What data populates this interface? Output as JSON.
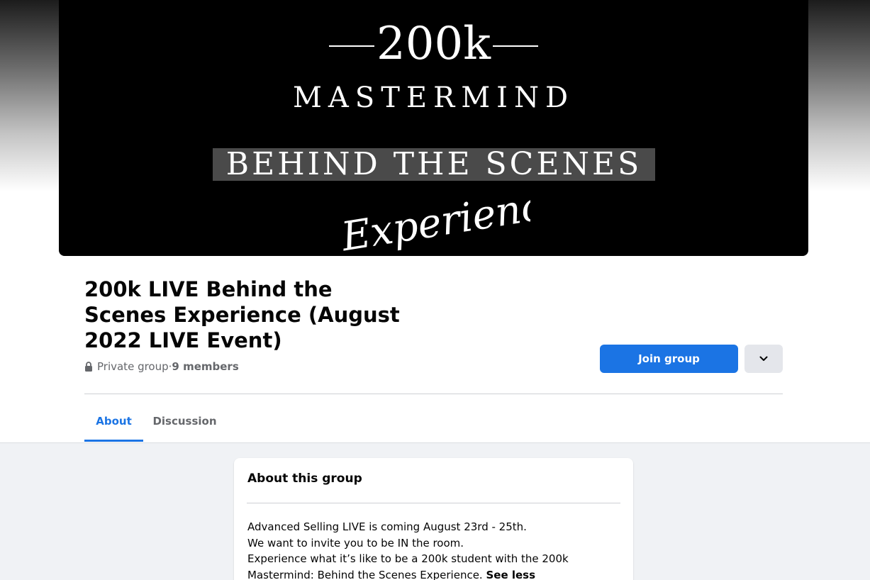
{
  "cover": {
    "line1": "200k",
    "line2": "MASTERMIND",
    "line3": "BEHIND THE SCENES",
    "line4": "Experience"
  },
  "group": {
    "title": "200k LIVE Behind the Scenes Experience (August 2022 LIVE Event)",
    "privacy": "Private group",
    "separator": " · ",
    "members": "9 members",
    "join_label": "Join group",
    "more_icon": "chevron-down-icon"
  },
  "tabs": [
    {
      "label": "About",
      "active": true
    },
    {
      "label": "Discussion",
      "active": false
    }
  ],
  "about": {
    "heading": "About this group",
    "lines": [
      "Advanced Selling LIVE is coming August 23rd - 25th.",
      "We want to invite you to be IN the room.",
      "Experience what it’s like to be a 200k student with the 200k",
      "Mastermind: Behind the Scenes Experience."
    ],
    "see_less": "See less"
  },
  "colors": {
    "accent": "#1b74e4",
    "background": "#f0f2f5",
    "secondary_text": "#65676b"
  }
}
